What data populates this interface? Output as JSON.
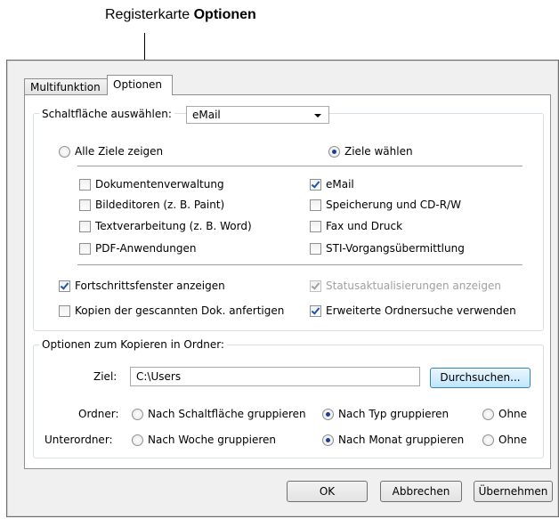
{
  "callout": {
    "prefix": "Registerkarte ",
    "bold": "Optionen"
  },
  "tabs": {
    "multifunktion": "Multifunktion",
    "optionen": "Optionen"
  },
  "button_select": {
    "label": "Schaltfläche auswählen:",
    "value": "eMail"
  },
  "targets": {
    "all_label": "Alle Ziele zeigen",
    "choose_label": "Ziele wählen",
    "left": [
      {
        "label": "Dokumentenverwaltung",
        "checked": false
      },
      {
        "label": "Bildeditoren (z. B. Paint)",
        "checked": false
      },
      {
        "label": "Textverarbeitung (z. B. Word)",
        "checked": false
      },
      {
        "label": "PDF-Anwendungen",
        "checked": false
      }
    ],
    "right": [
      {
        "label": "eMail",
        "checked": true
      },
      {
        "label": "Speicherung und CD-R/W",
        "checked": false
      },
      {
        "label": "Fax und Druck",
        "checked": false
      },
      {
        "label": "STI-Vorgangsübermittlung",
        "checked": false
      }
    ]
  },
  "options": {
    "progress": "Fortschrittsfenster anzeigen",
    "status_updates": "Statusaktualisierungen anzeigen",
    "copies": "Kopien der gescannten Dok. anfertigen",
    "extended_search": "Erweiterte Ordnersuche verwenden"
  },
  "copy_group": {
    "title": "Optionen zum Kopieren in Ordner:",
    "dest_label": "Ziel:",
    "dest_value": "C:\\Users",
    "browse": "Durchsuchen...",
    "folder_label": "Ordner:",
    "folder_opts": [
      "Nach Schaltfläche gruppieren",
      "Nach Typ gruppieren",
      "Ohne"
    ],
    "subfolder_label": "Unterordner:",
    "subfolder_opts": [
      "Nach Woche gruppieren",
      "Nach Monat gruppieren",
      "Ohne"
    ]
  },
  "footer": {
    "ok": "OK",
    "cancel": "Abbrechen",
    "apply": "Übernehmen"
  }
}
